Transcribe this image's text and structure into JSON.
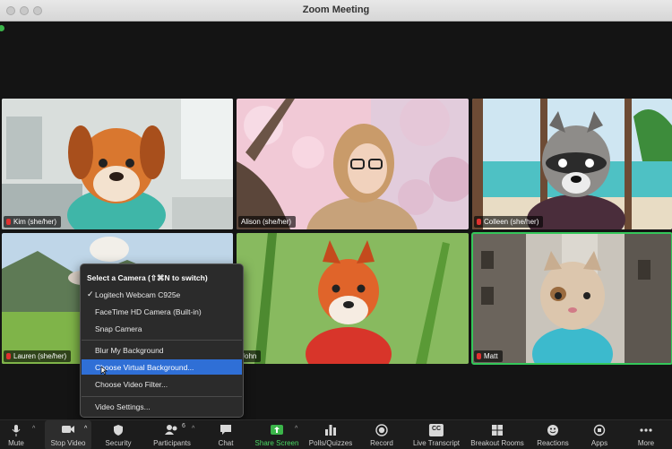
{
  "window": {
    "title": "Zoom Meeting"
  },
  "participants": [
    {
      "name": "Kim (she/her)"
    },
    {
      "name": "Alison (she/her)"
    },
    {
      "name": "Colleen (she/her)"
    },
    {
      "name": "Lauren (she/her)"
    },
    {
      "name": "John"
    },
    {
      "name": "Matt"
    }
  ],
  "camera_menu": {
    "header": "Select a Camera (⇧⌘N to switch)",
    "checkmark": "✓",
    "cameras": [
      "Logitech Webcam C925e",
      "FaceTime HD Camera (Built-in)",
      "Snap Camera"
    ],
    "blur": "Blur My Background",
    "virtual_bg": "Choose Virtual Background...",
    "video_filter": "Choose Video Filter...",
    "settings": "Video Settings..."
  },
  "toolbar": {
    "mute": "Mute",
    "stop_video": "Stop Video",
    "security": "Security",
    "participants": "Participants",
    "participants_count": "6",
    "chat": "Chat",
    "share_screen": "Share Screen",
    "polls": "Polls/Quizzes",
    "record": "Record",
    "live_transcript": "Live Transcript",
    "cc": "CC",
    "breakout": "Breakout Rooms",
    "reactions": "Reactions",
    "apps": "Apps",
    "more": "More"
  },
  "colors": {
    "accent_green": "#3bb54a",
    "menu_highlight": "#2f6fd6",
    "muted_red": "#e0312f"
  }
}
